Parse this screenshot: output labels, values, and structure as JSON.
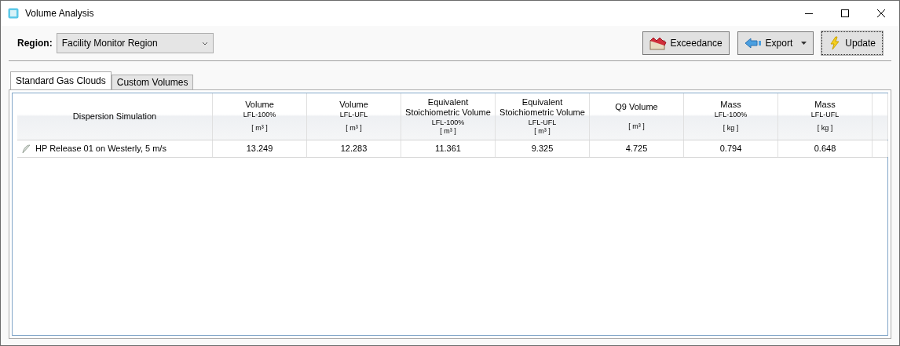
{
  "window": {
    "title": "Volume Analysis"
  },
  "region": {
    "label": "Region:",
    "value": "Facility Monitor Region"
  },
  "buttons": [
    {
      "label": "Exceedance",
      "kind": "chart",
      "dropdown": false,
      "focused": false
    },
    {
      "label": "Export",
      "kind": "export",
      "dropdown": true,
      "focused": false
    },
    {
      "label": "Update",
      "kind": "update",
      "dropdown": false,
      "focused": true
    }
  ],
  "tabs": [
    {
      "label": "Standard Gas Clouds",
      "selected": true
    },
    {
      "label": "Custom Volumes",
      "selected": false
    }
  ],
  "table": {
    "columns": [
      {
        "title": "Dispersion Simulation"
      },
      {
        "title": "Volume",
        "sub": "LFL-100%",
        "unit": "[ m³ ]"
      },
      {
        "title": "Volume",
        "sub": "LFL-UFL",
        "unit": "[ m³ ]"
      },
      {
        "title": "Equivalent Stoichiometric Volume",
        "sub": "LFL-100%",
        "unit": "[ m³ ]"
      },
      {
        "title": "Equivalent Stoichiometric Volume",
        "sub": "LFL-UFL",
        "unit": "[ m³ ]"
      },
      {
        "title": "Q9 Volume",
        "unit": "[ m³ ]"
      },
      {
        "title": "Mass",
        "sub": "LFL-100%",
        "unit": "[ kg ]"
      },
      {
        "title": "Mass",
        "sub": "LFL-UFL",
        "unit": "[ kg ]"
      }
    ],
    "rows": [
      {
        "cells": [
          "HP Release 01 on Westerly, 5 m/s",
          "13.249",
          "12.283",
          "11.361",
          "9.325",
          "4.725",
          "0.794",
          "0.648"
        ]
      }
    ]
  }
}
